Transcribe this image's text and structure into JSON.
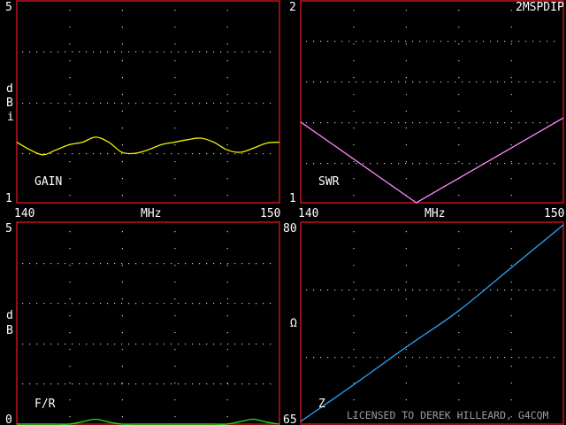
{
  "app_title": "2MSPDIP",
  "license_text": "LICENSED TO DEREK HILLEARD, G4CQM",
  "colors": {
    "frame": "#c0141e",
    "gain": "#f0f000",
    "swr": "#ff88ff",
    "fr": "#22dd22",
    "z": "#2aa8ff",
    "grid": "#c8c8c8"
  },
  "chart_data": [
    {
      "type": "line",
      "panel": "top-left",
      "title": "GAIN",
      "ylabel": [
        "d",
        "B",
        "i"
      ],
      "xlabel": "",
      "xlim": [
        140,
        150
      ],
      "ylim": [
        1,
        5
      ],
      "ytick_labels": {
        "top": "5",
        "bottom": "1"
      },
      "xtick_labels": {
        "left": "140",
        "right": "150"
      },
      "series": [
        {
          "x": [
            140,
            140.5,
            141,
            141.5,
            142,
            142.5,
            143,
            143.5,
            144,
            144.5,
            145,
            145.5,
            146,
            146.5,
            147,
            147.5,
            148,
            148.5,
            149,
            149.5,
            150
          ],
          "y": [
            2.2,
            2.05,
            1.95,
            2.05,
            2.15,
            2.2,
            2.3,
            2.2,
            2.0,
            1.98,
            2.05,
            2.15,
            2.2,
            2.25,
            2.28,
            2.2,
            2.05,
            2.0,
            2.08,
            2.18,
            2.2
          ]
        }
      ]
    },
    {
      "type": "line",
      "panel": "top-right",
      "title": "SWR",
      "xlabel": "MHz",
      "xlim": [
        140,
        150
      ],
      "ylim": [
        1,
        2
      ],
      "ytick_labels": {
        "top": "2",
        "bottom": "1"
      },
      "xtick_labels": {
        "left": "140",
        "right": "150"
      },
      "series": [
        {
          "x": [
            140,
            144.4,
            150
          ],
          "y": [
            1.4,
            1.0,
            1.42
          ]
        }
      ]
    },
    {
      "type": "line",
      "panel": "bottom-left",
      "title": "F/R",
      "ylabel": [
        "d",
        "B"
      ],
      "xlabel": "MHz",
      "xlim": [
        140,
        150
      ],
      "ylim": [
        0,
        5
      ],
      "ytick_labels": {
        "top": "5",
        "bottom": "0"
      },
      "series": [
        {
          "x": [
            140,
            140.5,
            141,
            141.5,
            142,
            142.5,
            143,
            143.5,
            144,
            144.5,
            145,
            145.5,
            146,
            146.5,
            147,
            147.5,
            148,
            148.5,
            149,
            149.5,
            150
          ],
          "y": [
            0,
            0,
            0,
            0,
            0,
            0.06,
            0.12,
            0.05,
            0,
            0,
            0,
            0,
            0,
            0,
            0,
            0,
            0,
            0.06,
            0.12,
            0.05,
            0
          ]
        }
      ]
    },
    {
      "type": "line",
      "panel": "bottom-right",
      "title": "Z",
      "ylabel": [
        "Ω"
      ],
      "xlim": [
        140,
        150
      ],
      "ylim": [
        65,
        80
      ],
      "ytick_labels": {
        "top": "80",
        "bottom": "65"
      },
      "series": [
        {
          "x": [
            140,
            142,
            144,
            146,
            148,
            150
          ],
          "y": [
            65.2,
            67.9,
            70.7,
            73.4,
            76.6,
            79.8
          ]
        }
      ]
    }
  ]
}
